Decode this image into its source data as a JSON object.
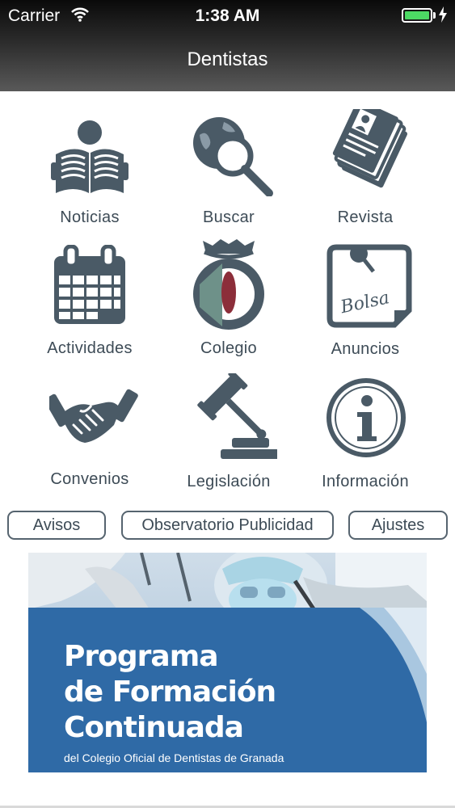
{
  "status_bar": {
    "carrier": "Carrier",
    "time": "1:38 AM"
  },
  "nav": {
    "title": "Dentistas"
  },
  "grid": [
    {
      "label": "Noticias",
      "icon": "newspaper-reader-icon"
    },
    {
      "label": "Buscar",
      "icon": "globe-search-icon"
    },
    {
      "label": "Revista",
      "icon": "magazine-stack-icon"
    },
    {
      "label": "Actividades",
      "icon": "calendar-icon"
    },
    {
      "label": "Colegio",
      "icon": "college-emblem-icon"
    },
    {
      "label": "Anuncios",
      "icon": "bolsa-notice-icon"
    },
    {
      "label": "Convenios",
      "icon": "handshake-icon"
    },
    {
      "label": "Legislación",
      "icon": "gavel-icon"
    },
    {
      "label": "Información",
      "icon": "info-icon"
    }
  ],
  "buttons": {
    "avisos": "Avisos",
    "observatorio": "Observatorio Publicidad",
    "ajustes": "Ajustes"
  },
  "banner": {
    "line1": "Programa",
    "line2": "de Formación",
    "line3": "Continuada",
    "subtitle": "del Colegio Oficial de Dentistas de Granada"
  },
  "colors": {
    "icon": "#4a5a66",
    "accent_red": "#8c2e3a",
    "banner_blue": "#2f6aa6",
    "battery": "#4cd964"
  }
}
